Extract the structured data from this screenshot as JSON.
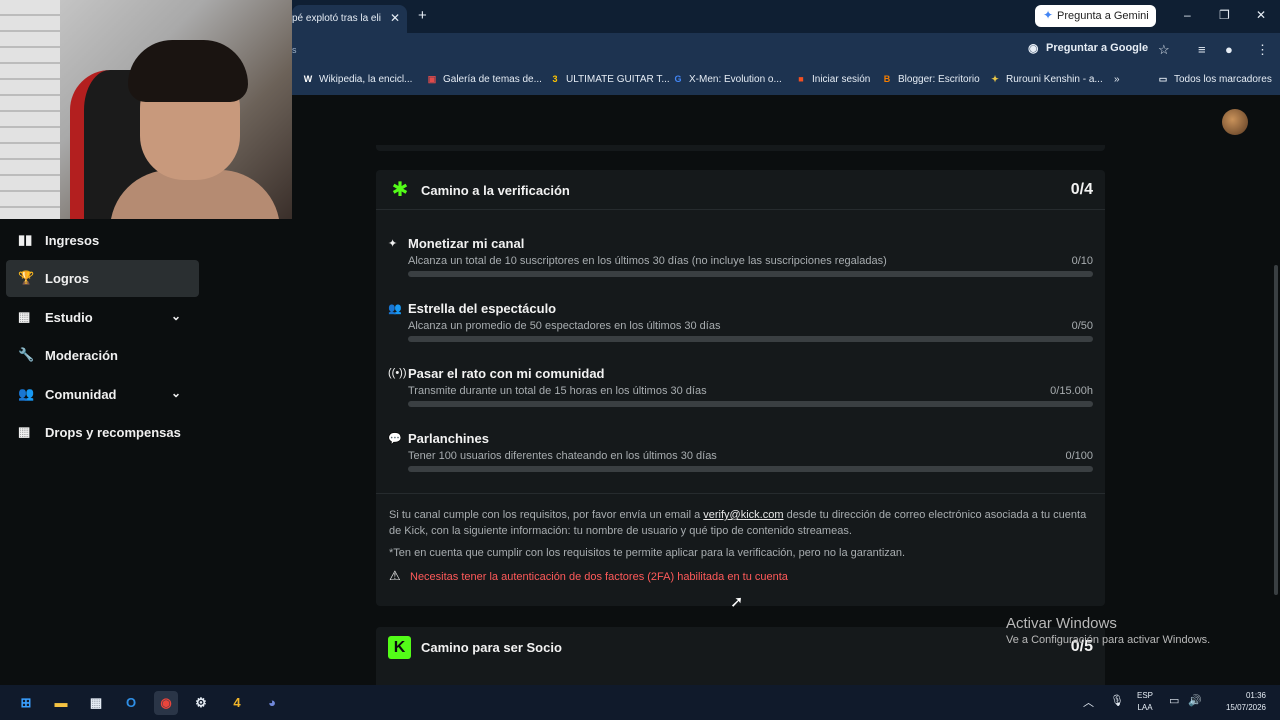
{
  "browser": {
    "tab_title": "pé explotó tras la eli",
    "tab_close": "✕",
    "new_tab": "+",
    "gemini_button": "Pregunta a Gemini",
    "url_fragment": "s",
    "ask_google": "Preguntar a Google",
    "window_controls": [
      "–",
      "❐",
      "✕"
    ],
    "bookmarks": [
      {
        "label": "Wikipedia, la encicl...",
        "fav": "W",
        "color": "#ffffff"
      },
      {
        "label": "Galería de temas de...",
        "fav": "▣",
        "color": "#e04b4b"
      },
      {
        "label": "ULTIMATE GUITAR T...",
        "fav": "3",
        "color": "#ffc400"
      },
      {
        "label": "X-Men: Evolution o...",
        "fav": "G",
        "color": "#4285f4"
      },
      {
        "label": "Iniciar sesión",
        "fav": "■",
        "color": "#f25022"
      },
      {
        "label": "Blogger: Escritorio",
        "fav": "B",
        "color": "#f57d00"
      },
      {
        "label": "Rurouni Kenshin - a...",
        "fav": "✦",
        "color": "#e8c547"
      }
    ],
    "bookmarks_more": "»",
    "all_bookmarks": "Todos los marcadores"
  },
  "sidebar": {
    "items": [
      {
        "label": "Ingresos",
        "icon": "▮▮"
      },
      {
        "label": "Logros",
        "icon": "🏆"
      },
      {
        "label": "Estudio",
        "icon": "▦"
      },
      {
        "label": "Moderación",
        "icon": "🔧"
      },
      {
        "label": "Comunidad",
        "icon": "👥"
      },
      {
        "label": "Drops y recompensas",
        "icon": "▦"
      }
    ]
  },
  "verification": {
    "title": "Camino a la verificación",
    "count": "0/4",
    "requirements": [
      {
        "title": "Monetizar mi canal",
        "desc": "Alcanza un total de 10 suscriptores en los últimos 30 días (no incluye las suscripciones regaladas)",
        "progress": "0/10",
        "fraction": 0
      },
      {
        "title": "Estrella del espectáculo",
        "desc": "Alcanza un promedio de 50 espectadores en los últimos 30 días",
        "progress": "0/50",
        "fraction": 0
      },
      {
        "title": "Pasar el rato con mi comunidad",
        "desc": "Transmite durante un total de 15 horas en los últimos 30 días",
        "progress": "0/15.00h",
        "fraction": 0
      },
      {
        "title": "Parlanchines",
        "desc": "Tener 100 usuarios diferentes chateando en los últimos 30 días",
        "progress": "0/100",
        "fraction": 0
      }
    ],
    "info_pre": "Si tu canal cumple con los requisitos, por favor envía un email a ",
    "info_link": "verify@kick.com",
    "info_post": " desde tu dirección de correo electrónico asociada a tu cuenta de Kick, con la siguiente información: tu nombre de usuario y qué tipo de contenido streameas.",
    "note": "*Ten en cuenta que cumplir con los requisitos te permite aplicar para la verificación, pero no la garantizan.",
    "warning": "Necesitas tener la autenticación de dos factores (2FA) habilitada en tu cuenta"
  },
  "partner": {
    "title": "Camino para ser Socio",
    "count": "0/5"
  },
  "windows": {
    "activate_title": "Activar Windows",
    "activate_sub": "Ve a Configuración para activar Windows."
  },
  "taskbar": {
    "lang_1": "ESP",
    "lang_2": "LAA",
    "time": "01:36",
    "date": "15/07/2026"
  }
}
